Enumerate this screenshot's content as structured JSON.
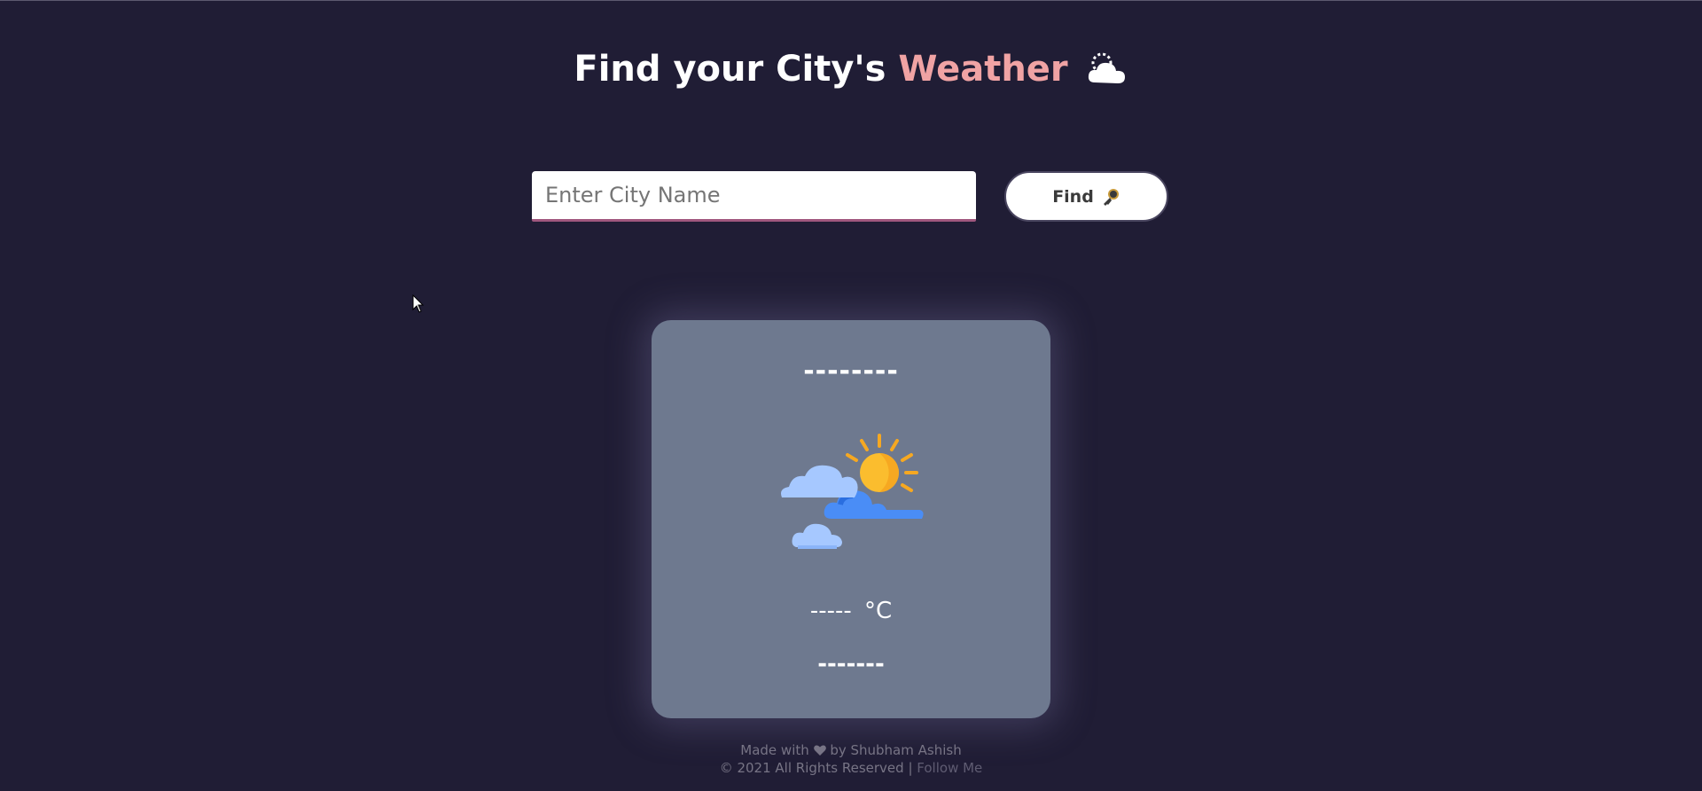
{
  "header": {
    "title_part1": "Find your City's",
    "title_accent": "Weather",
    "icon": "cloud-icon"
  },
  "search": {
    "placeholder": "Enter City Name",
    "value": "",
    "button_label": "Find",
    "button_icon": "key-icon"
  },
  "weather_card": {
    "city": "--------",
    "icon": "sun-behind-clouds-icon",
    "temperature": "-----",
    "unit": "°C",
    "condition": "-------"
  },
  "footer": {
    "made_with_prefix": "Made with",
    "made_with_suffix": "by Shubham Ashish",
    "copyright": "© 2021 All Rights Reserved |",
    "follow_label": "Follow Me"
  },
  "colors": {
    "background": "#201d35",
    "accent": "#f0a3a4",
    "card": "#6e798f",
    "input_underline": "#a0577e"
  }
}
